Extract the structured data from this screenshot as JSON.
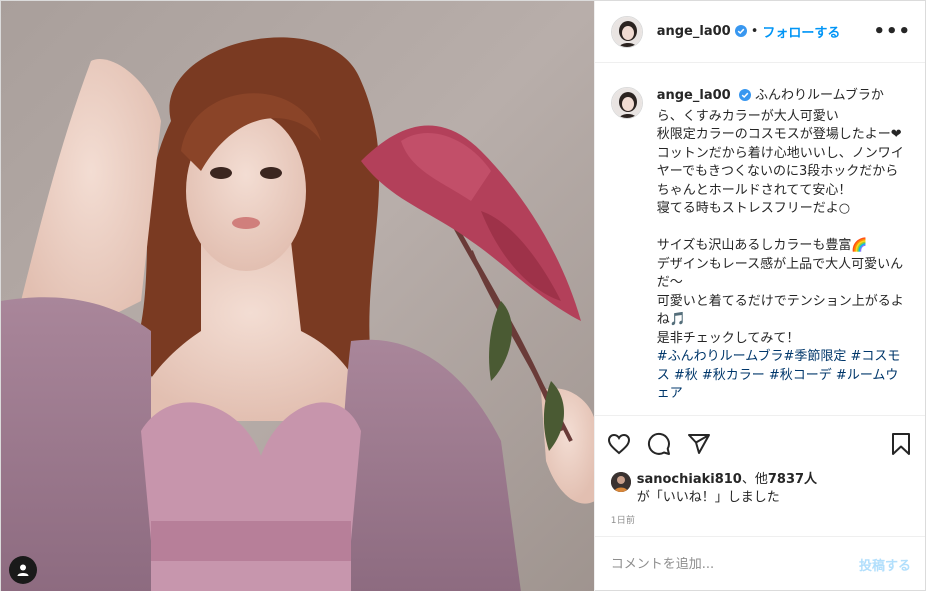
{
  "photo": {
    "alt_icon": "user-tag-icon"
  },
  "header": {
    "username": "ange_la00",
    "separator": "•",
    "follow_label": "フォローする",
    "more_label": "•••"
  },
  "caption": {
    "username": "ange_la00",
    "text": "ふんわりルームブラから、くすみカラーが大人可愛い\n秋限定カラーのコスモスが登場したよー❤\nコットンだから着け心地いいし、ノンワイヤーでもきつくないのに3段ホックだから\nちゃんとホールドされてて安心！\n寝てる時もストレスフリーだよ○\n\nサイズも沢山あるしカラーも豊富🌈\nデザインもレース感が上品で大人可愛いんだ〜\n可愛いと着てるだけでテンション上がるよね🎵\n是非チェックしてみて！\n",
    "hashtags": "#ふんわりルームブラ#季節限定 #コスモス #秋 #秋カラー #秋コーデ #ルームウェア"
  },
  "actions": {
    "like_icon": "heart-icon",
    "comment_icon": "comment-icon",
    "share_icon": "share-icon",
    "save_icon": "bookmark-icon"
  },
  "likes": {
    "user": "sanochiaki810",
    "suffix": "、他",
    "count": "7837人",
    "line2": "が「いいね！」しました"
  },
  "time": "1日前",
  "comment": {
    "placeholder": "コメントを追加...",
    "post_label": "投稿する"
  },
  "colors": {
    "accent": "#0095f6",
    "verified": "#3897f0",
    "hashtag": "#00376b",
    "post_disabled": "#b2dffc"
  }
}
